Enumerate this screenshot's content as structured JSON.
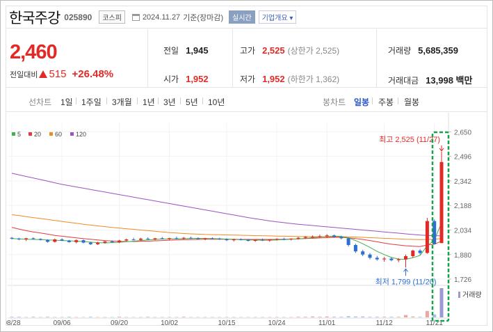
{
  "header": {
    "stock_name": "한국주강",
    "stock_code": "025890",
    "market_tag": "코스피",
    "date": "2024.11.27",
    "basis": "기준(장마감)",
    "realtime_btn": "실시간",
    "company_btn": "기업개요 ▾"
  },
  "price": {
    "current": "2,460",
    "change_label": "전일대비",
    "change_value": "515",
    "change_pct": "+26.48%"
  },
  "stats": {
    "prev_label": "전일",
    "prev_value": "1,945",
    "high_label": "고가",
    "high_value": "2,525",
    "high_sub": "(상한가 2,525)",
    "volume_label": "거래량",
    "volume_value": "5,685,359",
    "open_label": "시가",
    "open_value": "1,952",
    "low_label": "저가",
    "low_value": "1,952",
    "low_sub": "(하한가 1,362)",
    "amount_label": "거래대금",
    "amount_value": "13,998 백만"
  },
  "toolbar": {
    "line_head": "선차트",
    "line_periods": [
      "1일",
      "1주일",
      "3개월",
      "1년",
      "3년",
      "5년",
      "10년"
    ],
    "candle_head": "봉차트",
    "candle_periods": [
      "일봉",
      "주봉",
      "월봉"
    ],
    "active_candle": "일봉"
  },
  "colors": {
    "up": "#e22926",
    "down": "#2d6ed4",
    "ma5": "#43b04a",
    "ma20": "#e5393b",
    "ma60": "#f08a24",
    "ma120": "#9a52c4",
    "highlight": "#12a34a"
  },
  "chart_data": {
    "type": "candlestick",
    "legend": [
      {
        "name": "5",
        "color": "#43b04a"
      },
      {
        "name": "20",
        "color": "#e5393b"
      },
      {
        "name": "60",
        "color": "#f08a24"
      },
      {
        "name": "120",
        "color": "#9a52c4"
      }
    ],
    "ylim": [
      1700,
      2660
    ],
    "y_ticks": [
      "2,650",
      "2,496",
      "2,342",
      "2,188",
      "2,034",
      "1,880",
      "1,726"
    ],
    "y_tick_values": [
      2650,
      2496,
      2342,
      2188,
      2034,
      1880,
      1726
    ],
    "x_ticks": [
      "08/28",
      "09/06",
      "09/20",
      "10/02",
      "10/15",
      "10/24",
      "11/01",
      "11/12",
      "11/21"
    ],
    "x_tick_index": [
      0,
      7,
      15,
      22,
      30,
      37,
      44,
      52,
      59
    ],
    "high_annotation": "최고 2,525 (11/27)",
    "low_annotation": "최저 1,799 (11/20)",
    "volume_label": "거래량",
    "candles": [
      [
        1985,
        1990,
        1975,
        1980
      ],
      [
        1980,
        1985,
        1970,
        1975
      ],
      [
        1975,
        1985,
        1965,
        1982
      ],
      [
        1982,
        1988,
        1975,
        1978
      ],
      [
        1978,
        1982,
        1968,
        1972
      ],
      [
        1972,
        1976,
        1955,
        1960
      ],
      [
        1960,
        1980,
        1955,
        1975
      ],
      [
        1975,
        1982,
        1965,
        1968
      ],
      [
        1968,
        1972,
        1955,
        1958
      ],
      [
        1958,
        1975,
        1950,
        1970
      ],
      [
        1970,
        1975,
        1950,
        1955
      ],
      [
        1955,
        1960,
        1940,
        1945
      ],
      [
        1945,
        1960,
        1940,
        1955
      ],
      [
        1955,
        1965,
        1948,
        1962
      ],
      [
        1962,
        1970,
        1955,
        1958
      ],
      [
        1958,
        1972,
        1952,
        1968
      ],
      [
        1968,
        1980,
        1962,
        1975
      ],
      [
        1975,
        1985,
        1968,
        1972
      ],
      [
        1972,
        1985,
        1965,
        1980
      ],
      [
        1980,
        1988,
        1972,
        1976
      ],
      [
        1976,
        1985,
        1970,
        1982
      ],
      [
        1982,
        1990,
        1975,
        1978
      ],
      [
        1978,
        1985,
        1970,
        1983
      ],
      [
        1983,
        1992,
        1976,
        1980
      ],
      [
        1980,
        1990,
        1972,
        1985
      ],
      [
        1985,
        1992,
        1978,
        1982
      ],
      [
        1982,
        1988,
        1975,
        1978
      ],
      [
        1978,
        1985,
        1970,
        1982
      ],
      [
        1982,
        1988,
        1975,
        1980
      ],
      [
        1980,
        1985,
        1972,
        1976
      ],
      [
        1976,
        1982,
        1965,
        1970
      ],
      [
        1970,
        1980,
        1962,
        1975
      ],
      [
        1975,
        1982,
        1968,
        1972
      ],
      [
        1972,
        1978,
        1962,
        1966
      ],
      [
        1966,
        1975,
        1960,
        1972
      ],
      [
        1972,
        1980,
        1965,
        1968
      ],
      [
        1968,
        1976,
        1960,
        1974
      ],
      [
        1974,
        1982,
        1968,
        1978
      ],
      [
        1978,
        1985,
        1970,
        1975
      ],
      [
        1975,
        1982,
        1968,
        1980
      ],
      [
        1980,
        1990,
        1974,
        1985
      ],
      [
        1985,
        1995,
        1978,
        1990
      ],
      [
        1990,
        2000,
        1982,
        1992
      ],
      [
        1992,
        2005,
        1985,
        1995
      ],
      [
        1995,
        2008,
        1988,
        2000
      ],
      [
        2000,
        2005,
        1985,
        1990
      ],
      [
        1990,
        1998,
        1975,
        1982
      ],
      [
        1982,
        1988,
        1930,
        1940
      ],
      [
        1940,
        1948,
        1890,
        1900
      ],
      [
        1900,
        1910,
        1870,
        1880
      ],
      [
        1880,
        1890,
        1850,
        1860
      ],
      [
        1860,
        1872,
        1842,
        1850
      ],
      [
        1850,
        1865,
        1835,
        1855
      ],
      [
        1855,
        1862,
        1838,
        1845
      ],
      [
        1845,
        1858,
        1832,
        1850
      ],
      [
        1850,
        1880,
        1799,
        1870
      ],
      [
        1870,
        1910,
        1860,
        1905
      ],
      [
        1905,
        1915,
        1880,
        1890
      ],
      [
        1890,
        2110,
        1885,
        2090
      ],
      [
        2090,
        2100,
        1945,
        1945
      ],
      [
        1952,
        2525,
        1952,
        2460
      ]
    ],
    "ma5": [
      1980,
      1978,
      1976,
      1975,
      1974,
      1972,
      1970,
      1968,
      1966,
      1964,
      1962,
      1958,
      1955,
      1953,
      1955,
      1957,
      1960,
      1964,
      1968,
      1972,
      1975,
      1977,
      1978,
      1979,
      1980,
      1981,
      1982,
      1981,
      1980,
      1979,
      1977,
      1975,
      1973,
      1972,
      1971,
      1970,
      1970,
      1972,
      1974,
      1976,
      1978,
      1982,
      1986,
      1990,
      1994,
      1996,
      1994,
      1985,
      1968,
      1948,
      1925,
      1900,
      1880,
      1862,
      1852,
      1850,
      1860,
      1875,
      1935,
      1970,
      2080
    ],
    "ma20": [
      2050,
      2040,
      2030,
      2022,
      2015,
      2008,
      2000,
      1995,
      1990,
      1985,
      1980,
      1976,
      1972,
      1968,
      1965,
      1963,
      1962,
      1962,
      1963,
      1964,
      1966,
      1968,
      1970,
      1972,
      1973,
      1974,
      1975,
      1976,
      1976,
      1976,
      1976,
      1976,
      1975,
      1975,
      1975,
      1975,
      1975,
      1975,
      1976,
      1977,
      1978,
      1980,
      1982,
      1984,
      1986,
      1988,
      1988,
      1985,
      1980,
      1975,
      1968,
      1960,
      1952,
      1945,
      1940,
      1935,
      1932,
      1930,
      1940,
      1945,
      1965
    ],
    "ma60": [
      2130,
      2125,
      2118,
      2112,
      2106,
      2100,
      2094,
      2088,
      2082,
      2076,
      2070,
      2065,
      2060,
      2055,
      2050,
      2046,
      2042,
      2038,
      2034,
      2030,
      2026,
      2022,
      2018,
      2015,
      2012,
      2010,
      2008,
      2006,
      2005,
      2004,
      2003,
      2002,
      2001,
      2000,
      1999,
      1998,
      1997,
      1996,
      1995,
      1994,
      1993,
      1993,
      1992,
      1992,
      1992,
      1992,
      1992,
      1991,
      1990,
      1988,
      1986,
      1984,
      1982,
      1980,
      1978,
      1976,
      1975,
      1974,
      1975,
      1976,
      1980
    ],
    "ma120": [
      2390,
      2380,
      2370,
      2360,
      2350,
      2340,
      2330,
      2320,
      2312,
      2304,
      2296,
      2288,
      2280,
      2272,
      2264,
      2256,
      2248,
      2240,
      2232,
      2224,
      2216,
      2208,
      2200,
      2192,
      2184,
      2176,
      2168,
      2160,
      2152,
      2144,
      2136,
      2128,
      2120,
      2112,
      2105,
      2098,
      2091,
      2085,
      2080,
      2075,
      2070,
      2066,
      2062,
      2058,
      2054,
      2050,
      2046,
      2042,
      2038,
      2034,
      2030,
      2026,
      2022,
      2018,
      2014,
      2010,
      2006,
      2002,
      2000,
      1998,
      1998
    ],
    "volume": [
      2,
      2,
      1,
      2,
      1,
      2,
      1,
      1,
      2,
      1,
      1,
      2,
      1,
      1,
      1,
      2,
      1,
      1,
      1,
      2,
      1,
      1,
      1,
      1,
      2,
      1,
      1,
      1,
      1,
      1,
      1,
      1,
      1,
      1,
      1,
      1,
      1,
      1,
      1,
      1,
      2,
      2,
      3,
      2,
      3,
      2,
      2,
      4,
      3,
      3,
      2,
      2,
      2,
      2,
      2,
      8,
      3,
      2,
      22,
      10,
      100
    ]
  }
}
